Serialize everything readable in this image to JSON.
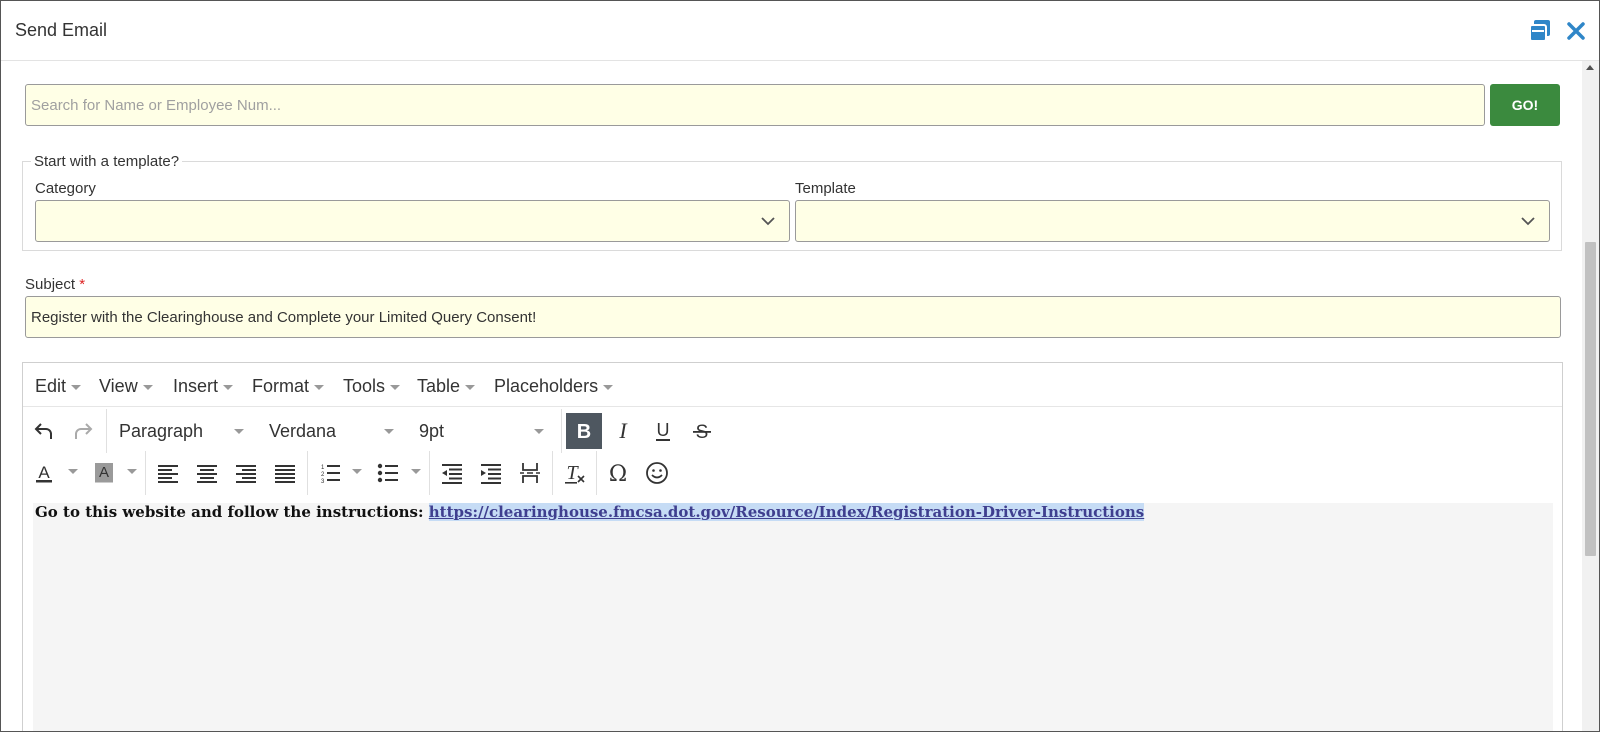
{
  "dialog": {
    "title": "Send Email"
  },
  "search": {
    "placeholder": "Search for Name or Employee Num...",
    "go_label": "GO!"
  },
  "template_section": {
    "legend": "Start with a template?",
    "category_label": "Category",
    "template_label": "Template"
  },
  "subject": {
    "label": "Subject",
    "required_mark": "*",
    "value": "Register with the Clearinghouse and Complete your Limited Query Consent!"
  },
  "editor": {
    "menus": [
      "Edit",
      "View",
      "Insert",
      "Format",
      "Tools",
      "Table",
      "Placeholders"
    ],
    "block_format": "Paragraph",
    "font_family": "Verdana",
    "font_size": "9pt",
    "icons": [
      "undo-icon",
      "redo-icon",
      "bold-icon",
      "italic-icon",
      "underline-icon",
      "strikethrough-icon",
      "text-color-icon",
      "background-color-icon",
      "align-left-icon",
      "align-center-icon",
      "align-right-icon",
      "justify-icon",
      "numbered-list-icon",
      "bullet-list-icon",
      "outdent-icon",
      "indent-icon",
      "page-break-icon",
      "clear-formatting-icon",
      "special-character-icon",
      "emoji-icon"
    ],
    "content": {
      "text": "Go to this website and follow the instructions: ",
      "link": "https://clearinghouse.fmcsa.dot.gov/Resource/Index/Registration-Driver-Instructions"
    }
  },
  "colors": {
    "input_bg": "#ffffe6",
    "go_button": "#3b8a3e",
    "title_icons": "#2f86c8",
    "active_button": "#4e5760"
  }
}
